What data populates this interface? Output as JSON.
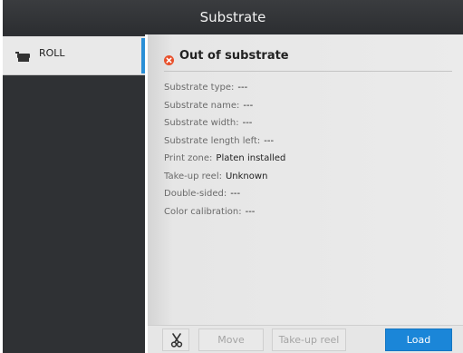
{
  "title": "Substrate",
  "sidebar": {
    "items": [
      {
        "label": "ROLL",
        "icon": "roll-icon"
      }
    ],
    "accent_color": "#2a8fd6"
  },
  "panel": {
    "status_title": "Out of substrate",
    "status_icon": "error-icon",
    "status_color": "#e8502b",
    "properties": [
      {
        "key": "Substrate type:",
        "value": "---"
      },
      {
        "key": "Substrate name:",
        "value": "---"
      },
      {
        "key": "Substrate width:",
        "value": "---"
      },
      {
        "key": "Substrate length left:",
        "value": "---"
      },
      {
        "key": "Print zone:",
        "value": "Platen installed"
      },
      {
        "key": "Take-up reel:",
        "value": "Unknown"
      },
      {
        "key": "Double-sided:",
        "value": "---"
      },
      {
        "key": "Color calibration:",
        "value": "---"
      }
    ]
  },
  "footer": {
    "cut_icon": "scissors-icon",
    "move_label": "Move",
    "takeup_label": "Take-up reel",
    "load_label": "Load",
    "primary_color": "#1b86d8"
  }
}
